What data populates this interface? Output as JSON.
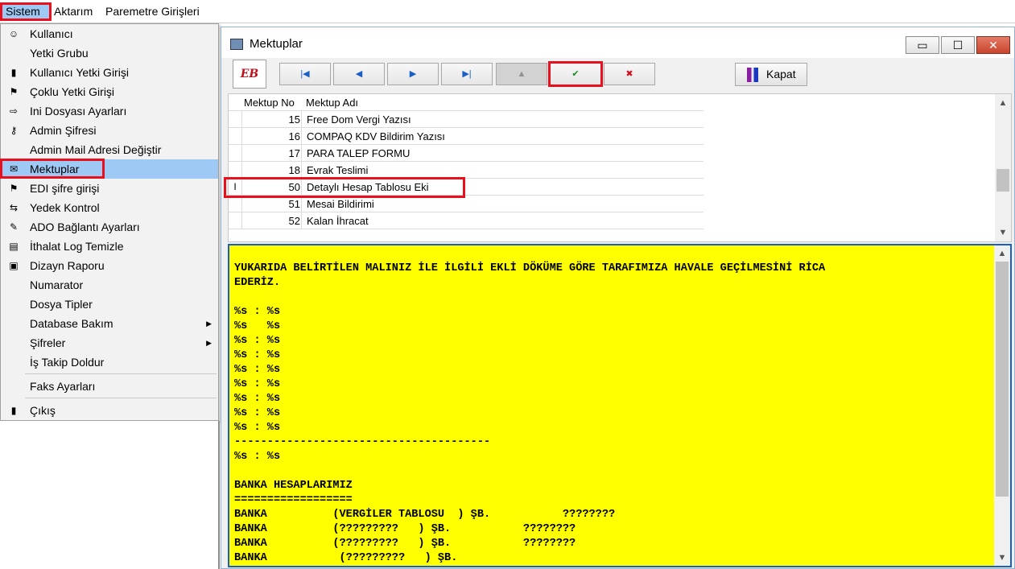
{
  "menubar": {
    "items": [
      {
        "label": "Sistem"
      },
      {
        "label": "Aktarım"
      },
      {
        "label": "Paremetre Girişleri"
      }
    ]
  },
  "dropdown": {
    "items": [
      {
        "label": "Kullanıcı",
        "icon": "user-icon"
      },
      {
        "label": "Yetki Grubu",
        "icon": ""
      },
      {
        "label": "Kullanıcı Yetki Girişi",
        "icon": "user-permission-icon"
      },
      {
        "label": "Çoklu Yetki Girişi",
        "icon": "multi-permission-icon"
      },
      {
        "label": "Ini Dosyası  Ayarları",
        "icon": "ini-file-icon"
      },
      {
        "label": "Admin Şifresi",
        "icon": "key-icon"
      },
      {
        "label": "Admin Mail Adresi Değiştir",
        "icon": ""
      },
      {
        "label": "Mektuplar",
        "icon": "letter-icon"
      },
      {
        "label": "EDI şifre girişi",
        "icon": "edi-key-icon"
      },
      {
        "label": "Yedek Kontrol",
        "icon": "backup-icon"
      },
      {
        "label": "ADO Bağlantı Ayarları",
        "icon": "connection-icon"
      },
      {
        "label": "İthalat Log Temizle",
        "icon": "log-clean-icon"
      },
      {
        "label": "Dizayn Raporu",
        "icon": "report-icon"
      },
      {
        "label": "Numarator",
        "icon": ""
      },
      {
        "label": "Dosya Tipler",
        "icon": ""
      },
      {
        "label": "Database Bakım",
        "icon": "",
        "submenu": true
      },
      {
        "label": "Şifreler",
        "icon": "",
        "submenu": true
      },
      {
        "label": "İş Takip Doldur",
        "icon": ""
      },
      {
        "label": "Faks Ayarları",
        "icon": ""
      },
      {
        "label": "Çıkış",
        "icon": "exit-icon"
      }
    ]
  },
  "window": {
    "title": "Mektuplar",
    "buttons": {
      "minimize": "▭",
      "maximize": "☐",
      "close": "✕"
    }
  },
  "toolbar": {
    "eb_label": "EB",
    "nav": {
      "first": "|◀",
      "prior": "◀",
      "next": "▶",
      "last": "▶|",
      "edit": "▲",
      "post": "✔",
      "cancel": "✖"
    },
    "close_label": "Kapat"
  },
  "grid": {
    "columns": {
      "no": "Mektup No",
      "name": "Mektup Adı"
    },
    "rows": [
      {
        "no": "15",
        "name": "Free Dom Vergi Yazısı",
        "indicator": ""
      },
      {
        "no": "16",
        "name": "COMPAQ KDV Bildirim Yazısı",
        "indicator": ""
      },
      {
        "no": "17",
        "name": "PARA TALEP FORMU",
        "indicator": ""
      },
      {
        "no": "18",
        "name": "Evrak Teslimi",
        "indicator": ""
      },
      {
        "no": "50",
        "name": "Detaylı Hesap Tablosu Eki",
        "indicator": "I"
      },
      {
        "no": "51",
        "name": "Mesai Bildirimi",
        "indicator": ""
      },
      {
        "no": "52",
        "name": "Kalan İhracat",
        "indicator": ""
      }
    ]
  },
  "memo": {
    "text": "YUKARIDA BELİRTİLEN MALINIZ İLE İLGİLİ EKLİ DÖKÜME GÖRE TARAFIMIZA HAVALE GEÇİLMESİNİ RİCA\nEDERİZ.\n\n%s : %s\n%s   %s\n%s : %s\n%s : %s\n%s : %s\n%s : %s\n%s : %s\n%s : %s\n%s : %s\n---------------------------------------\n%s : %s\n\nBANKA HESAPLARIMIZ\n==================\nBANKA          (VERGİLER TABLOSU  ) ŞB.           ????????\nBANKA          (?????????   ) ŞB.           ????????\nBANKA          (?????????   ) ŞB.           ????????\nBANKA           (?????????   ) ŞB."
  },
  "colors": {
    "highlight": "#e8101d",
    "selection": "#9ec9f5",
    "memo_bg": "#ffff00"
  }
}
